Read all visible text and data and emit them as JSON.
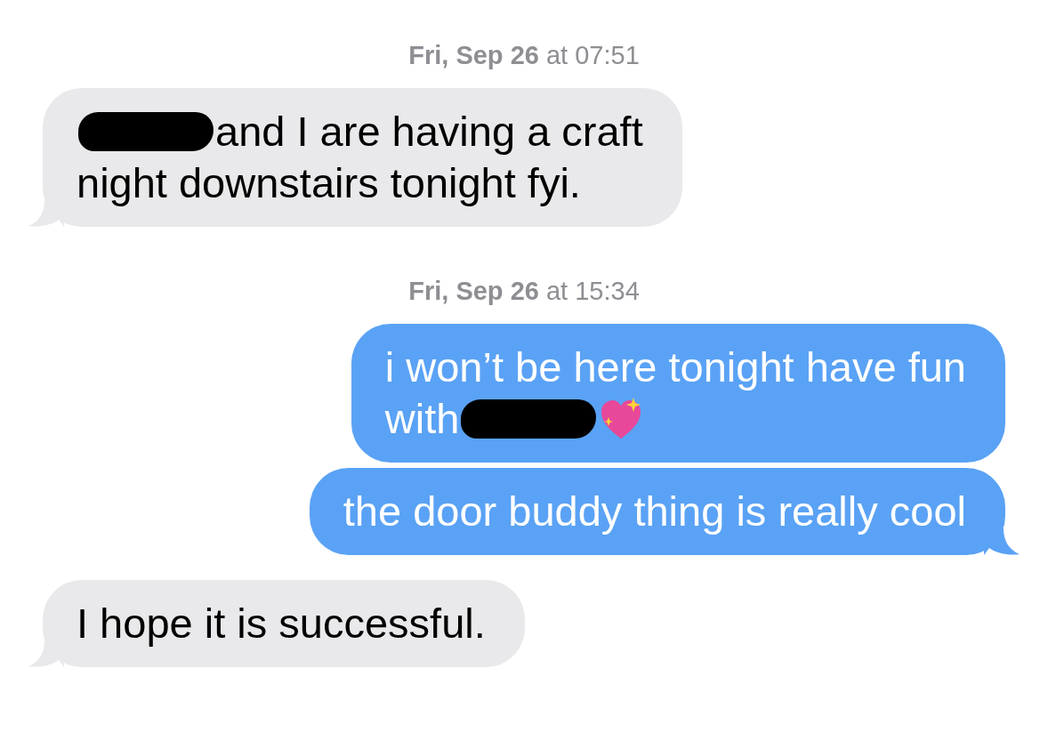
{
  "conversation": [
    {
      "kind": "timestamp",
      "text": "**Fri, Sep 26** at 07:51"
    },
    {
      "kind": "received",
      "tail": true,
      "lines": [
        [
          {
            "kind": "redaction"
          },
          {
            "kind": "text",
            "text": "and I are having a craft"
          }
        ],
        [
          {
            "kind": "text",
            "text": "night downstairs tonight fyi."
          }
        ]
      ]
    },
    {
      "kind": "timestamp",
      "text": "**Fri, Sep 26** at 15:34"
    },
    {
      "kind": "sent",
      "tail": false,
      "lines": [
        [
          {
            "kind": "text",
            "text": "i won’t be here tonight have fun"
          }
        ],
        [
          {
            "kind": "text",
            "text": "with"
          },
          {
            "kind": "redaction"
          },
          {
            "kind": "heart"
          }
        ]
      ]
    },
    {
      "kind": "sent",
      "tail": true,
      "lines": [
        [
          {
            "kind": "text",
            "text": "the door buddy thing is really cool"
          }
        ]
      ]
    },
    {
      "kind": "received",
      "tail": true,
      "lines": [
        [
          {
            "kind": "text",
            "text": "I hope it is successful."
          }
        ]
      ]
    }
  ]
}
